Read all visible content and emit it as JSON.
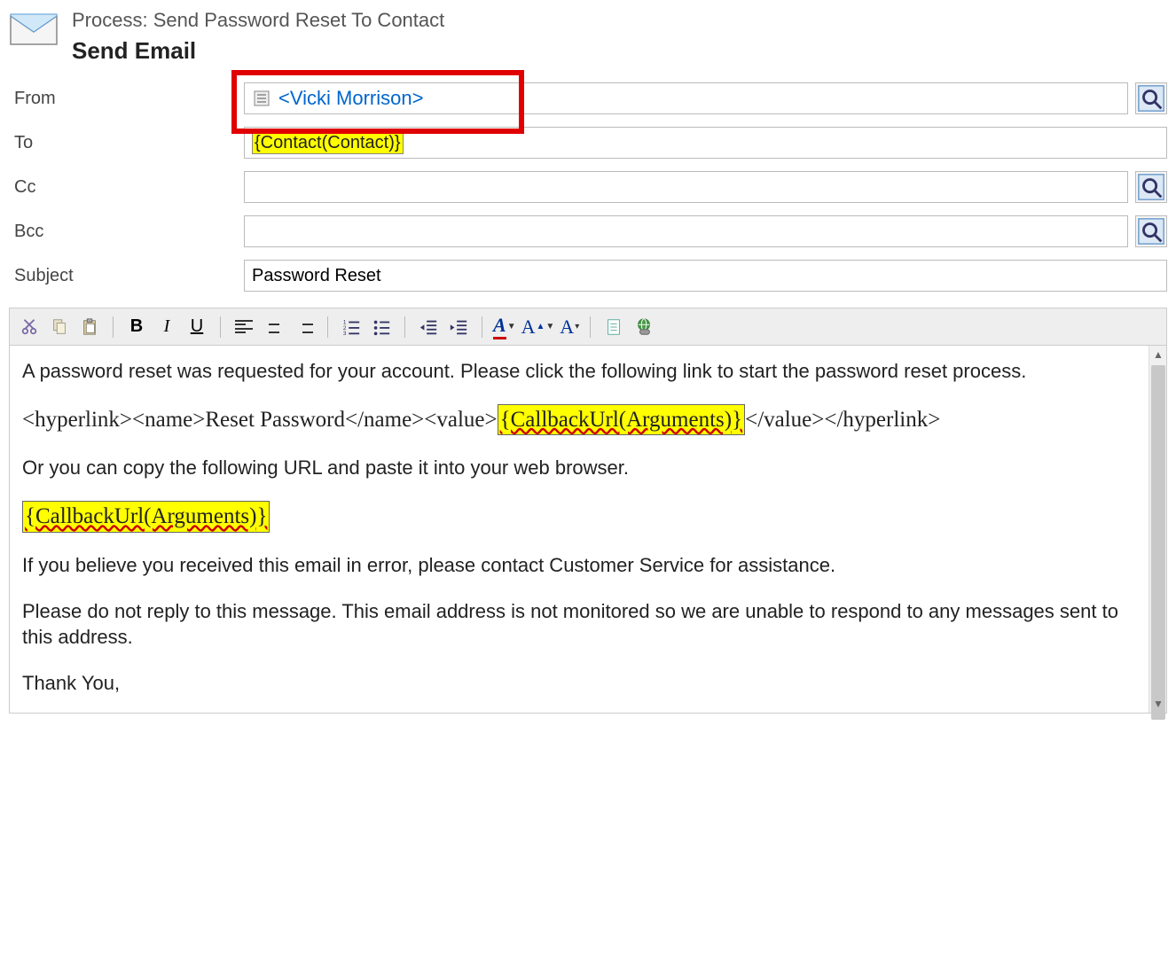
{
  "header": {
    "process_line": "Process: Send Password Reset To Contact",
    "title": "Send Email"
  },
  "fields": {
    "from_label": "From",
    "from_value": "<Vicki Morrison>",
    "to_label": "To",
    "to_chip": "{Contact(Contact)}",
    "cc_label": "Cc",
    "bcc_label": "Bcc",
    "subject_label": "Subject",
    "subject_value": "Password Reset"
  },
  "toolbar": {
    "bold": "B",
    "italic": "I",
    "underline": "U",
    "fontA1": "A",
    "fontA2": "A",
    "fontA3": "A"
  },
  "body": {
    "p1": "A password reset was requested for your account. Please click the following link to start the password reset process.",
    "hl_open": "<hyperlink><name>Reset Password</name><value>",
    "hl_chip": "{CallbackUrl(Arguments)}",
    "hl_close": "</value></hyperlink>",
    "p3": "Or you can copy the following URL and paste it into your web browser.",
    "callback_chip": "{CallbackUrl(Arguments)}",
    "p5": "If you believe you received this email in error, please contact Customer Service for assistance.",
    "p6": "Please do not reply to this message. This email address is not monitored so we are unable to respond to any messages sent to this address.",
    "p7": "Thank You,"
  }
}
